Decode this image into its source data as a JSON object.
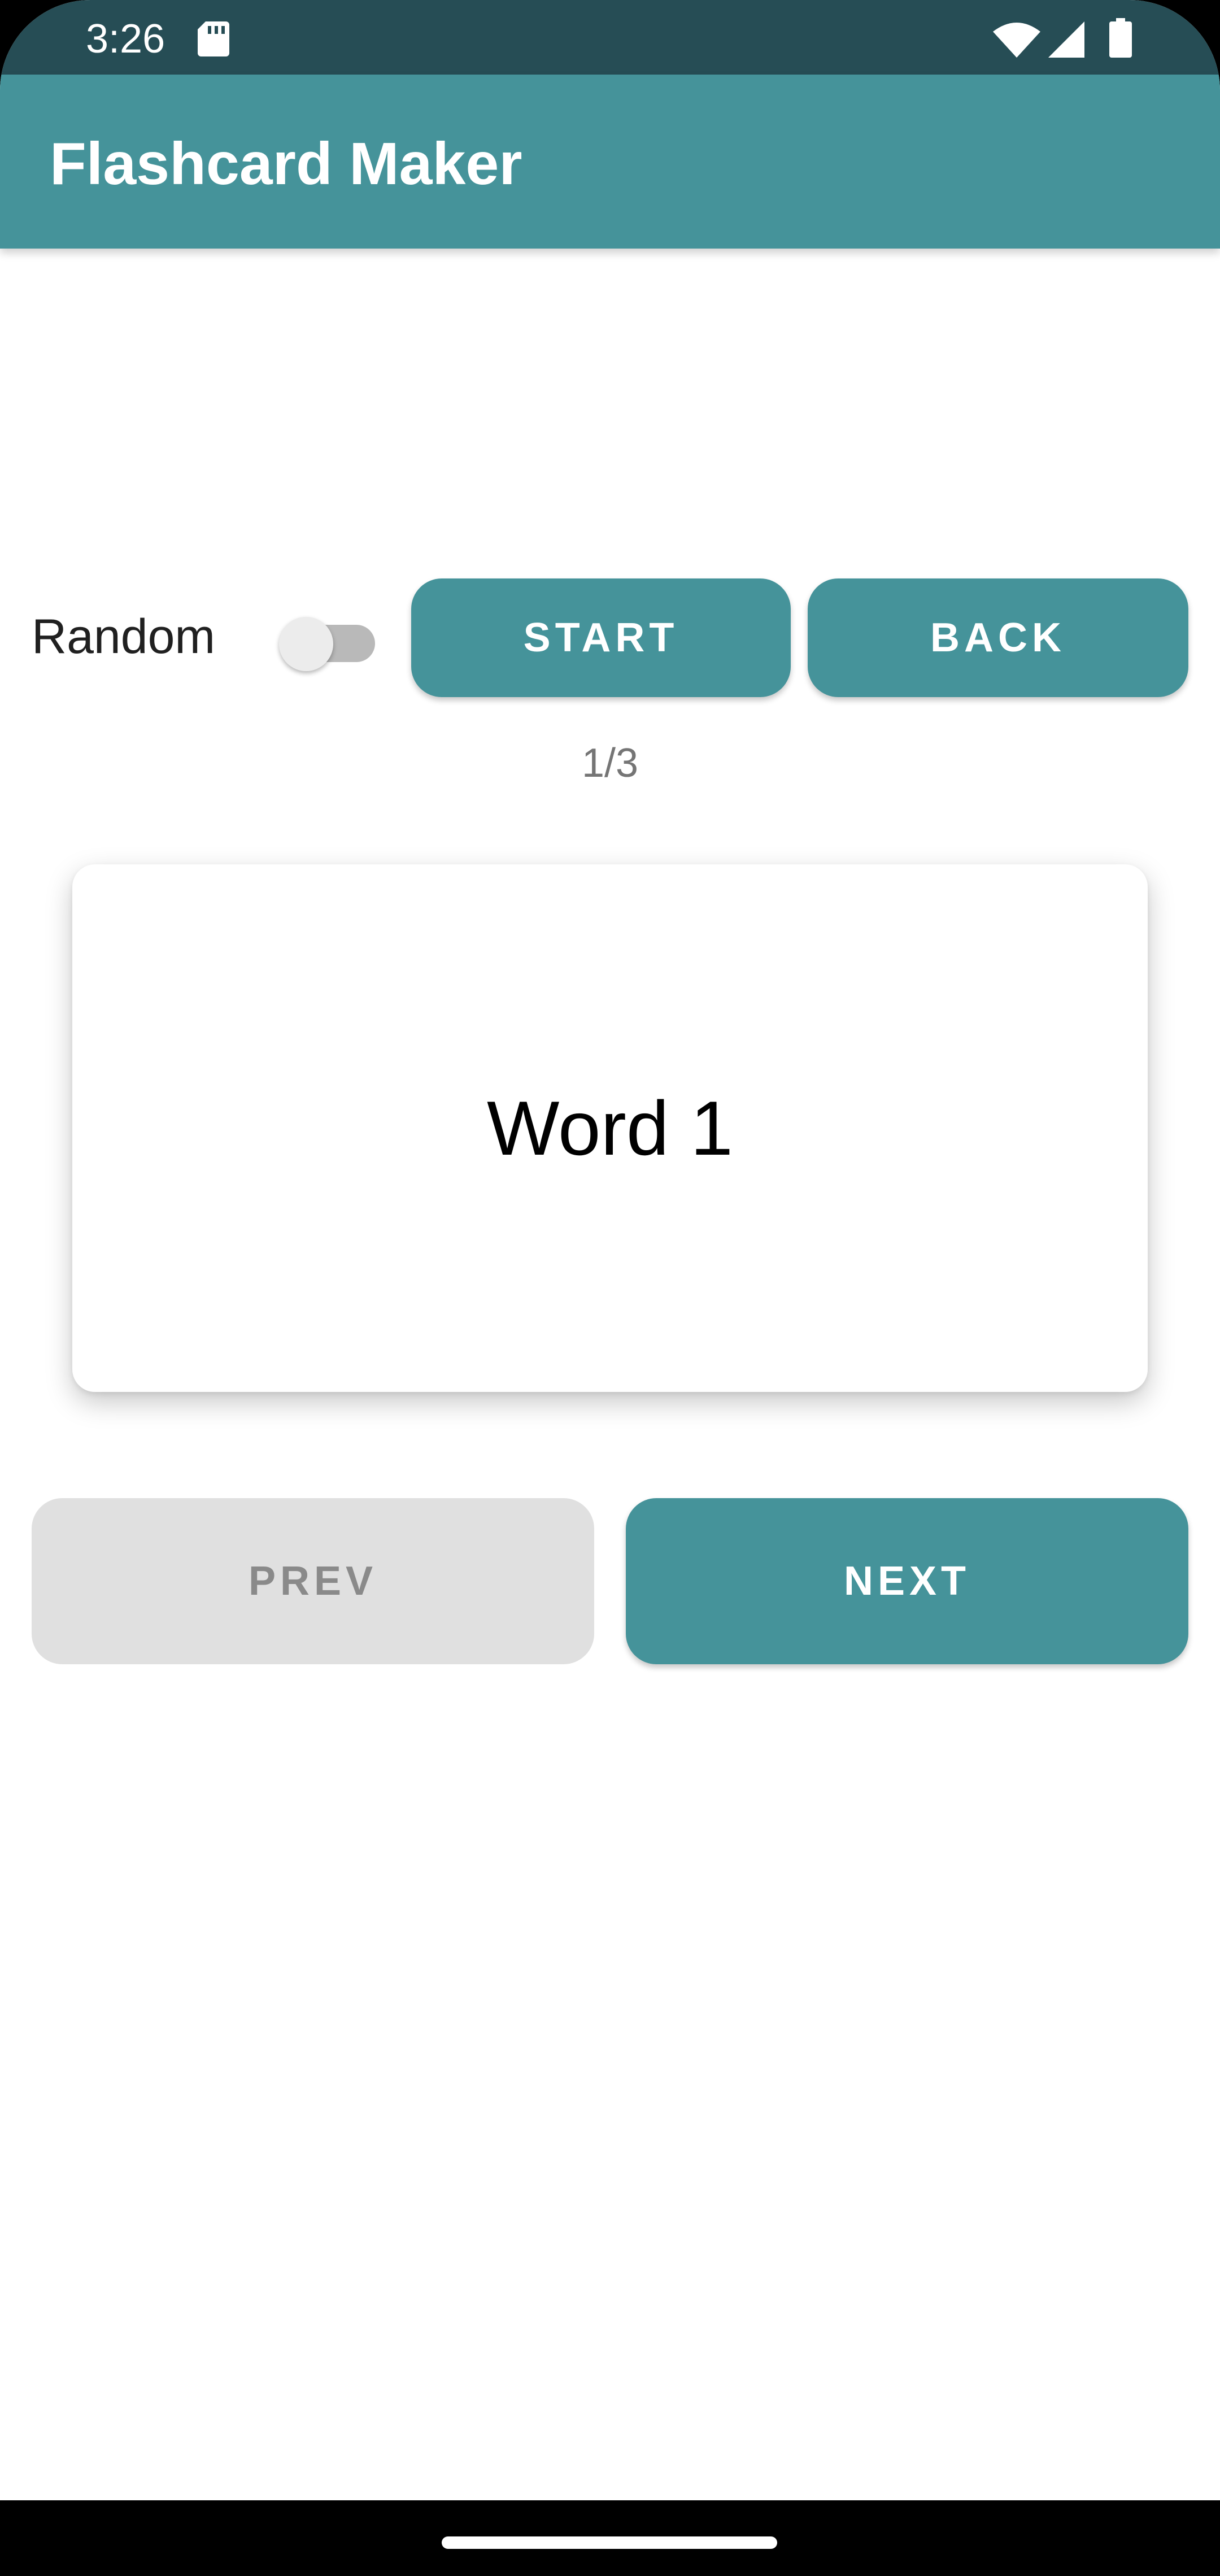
{
  "status_bar": {
    "time": "3:26",
    "icons": [
      "sd-card-icon",
      "wifi-icon",
      "signal-icon",
      "battery-icon"
    ]
  },
  "app_bar": {
    "title": "Flashcard Maker"
  },
  "controls": {
    "random_label": "Random",
    "random_enabled": false,
    "start_label": "START",
    "back_label": "BACK"
  },
  "counter": {
    "text": "1/3"
  },
  "card": {
    "word": "Word 1"
  },
  "navigation": {
    "prev_label": "PREV",
    "prev_enabled": false,
    "next_label": "NEXT"
  },
  "colors": {
    "status_bar": "#264d55",
    "primary": "#45939a",
    "disabled_button": "#e0e0e0",
    "disabled_text": "#8a8a8a",
    "counter_text": "#757575"
  }
}
